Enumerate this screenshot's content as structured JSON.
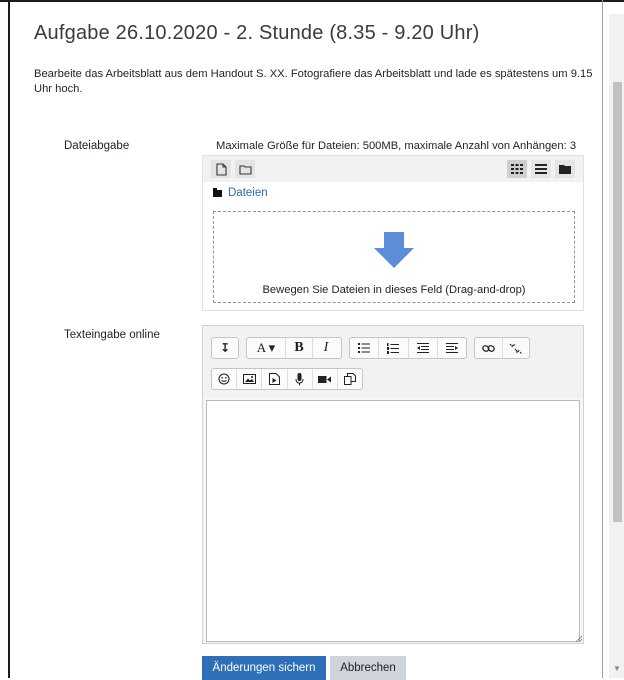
{
  "assignment": {
    "title": "Aufgabe 26.10.2020 - 2. Stunde (8.35 - 9.20 Uhr)",
    "description": "Bearbeite das Arbeitsblatt aus dem Handout S. XX. Fotografiere das Arbeitsblatt und lade es spätestens um 9.15 Uhr hoch."
  },
  "file_submission": {
    "label": "Dateiabgabe",
    "info": "Maximale Größe für Dateien: 500MB, maximale Anzahl von Anhängen: 3",
    "toolbar_icons": [
      "add-file-icon",
      "create-folder-icon",
      "grid-view-icon",
      "list-view-icon",
      "tree-view-icon"
    ],
    "path": "Dateien",
    "drop_text": "Bewegen Sie Dateien in dieses Feld (Drag-and-drop)"
  },
  "online_text": {
    "label": "Texteingabe online",
    "toolbar_row1": [
      "collapse-icon",
      "font-style-icon",
      "bold-icon",
      "italic-icon",
      "unordered-list-icon",
      "ordered-list-icon",
      "outdent-icon",
      "indent-icon",
      "link-icon",
      "unlink-icon"
    ],
    "toolbar_row2": [
      "emoji-icon",
      "image-icon",
      "media-icon",
      "record-audio-icon",
      "record-video-icon",
      "manage-files-icon"
    ],
    "value": ""
  },
  "actions": {
    "save_label": "Änderungen sichern",
    "cancel_label": "Abbrechen"
  },
  "colors": {
    "primary": "#2f6fb8",
    "link": "#2a6ab3",
    "arrow": "#5b8ed6"
  }
}
